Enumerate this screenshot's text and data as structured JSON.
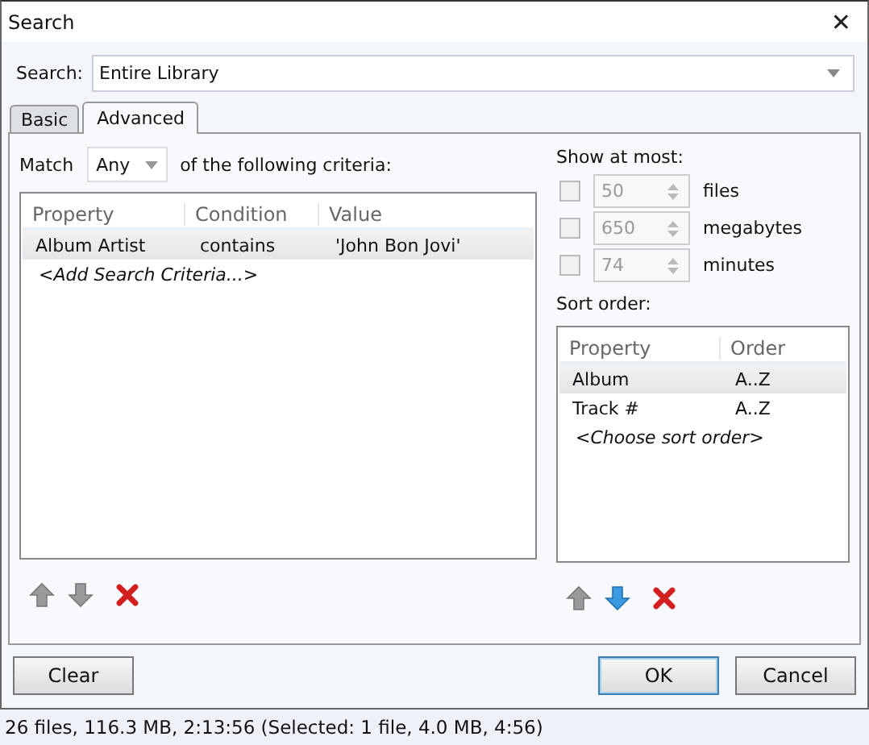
{
  "window": {
    "title": "Search",
    "close": "✕"
  },
  "search": {
    "label": "Search:",
    "value": "Entire Library"
  },
  "tabs": [
    {
      "label": "Basic",
      "selected": false
    },
    {
      "label": "Advanced",
      "selected": true
    }
  ],
  "match": {
    "label": "Match",
    "value": "Any",
    "suffix": "of the following criteria:"
  },
  "criteria": {
    "columns": [
      "Property",
      "Condition",
      "Value"
    ],
    "rows": [
      {
        "cells": [
          "Album Artist",
          "contains",
          "'John Bon Jovi'"
        ],
        "selected": true
      }
    ],
    "add": "<Add Search Criteria...>",
    "tools": [
      {
        "kind": "up",
        "disabled": true
      },
      {
        "kind": "down",
        "disabled": true
      },
      {
        "kind": "delete",
        "disabled": false
      }
    ]
  },
  "limits": {
    "label": "Show at most:",
    "items": [
      {
        "checked": false,
        "value": "50",
        "unit": "files"
      },
      {
        "checked": false,
        "value": "650",
        "unit": "megabytes"
      },
      {
        "checked": false,
        "value": "74",
        "unit": "minutes"
      }
    ]
  },
  "sort": {
    "label": "Sort order:",
    "columns": [
      "Property",
      "Order"
    ],
    "rows": [
      {
        "cells": [
          "Album",
          "A..Z"
        ],
        "selected": true
      },
      {
        "cells": [
          "Track #",
          "A..Z"
        ],
        "selected": false
      }
    ],
    "add": "<Choose sort order>",
    "tools": [
      {
        "kind": "up",
        "disabled": true
      },
      {
        "kind": "down",
        "disabled": false
      },
      {
        "kind": "delete",
        "disabled": false
      }
    ]
  },
  "buttons": [
    {
      "label": "Clear",
      "default": false
    },
    {
      "label": "OK",
      "default": true
    },
    {
      "label": "Cancel",
      "default": false
    }
  ],
  "status_bar": "26 files, 116.3 MB, 2:13:56 (Selected: 1 file, 4.0 MB, 4:56)"
}
